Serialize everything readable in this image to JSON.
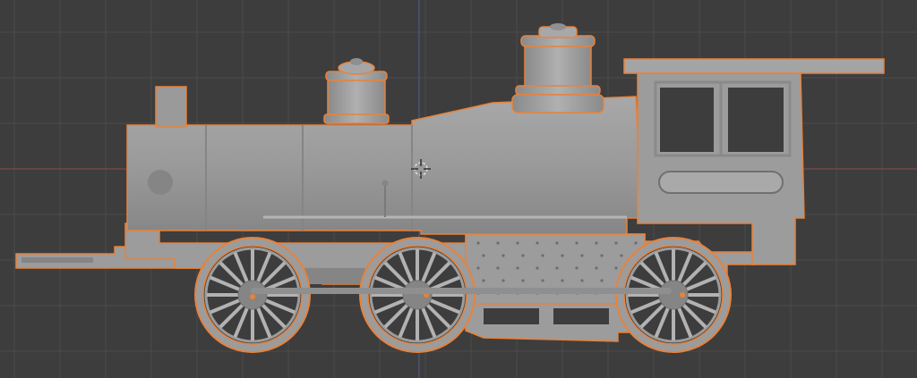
{
  "viewport": {
    "mode": "side-orthographic",
    "background": "#3d3d3d",
    "grid_color": "#4a4a4a",
    "x_axis_color": "#8a4a4a",
    "z_axis_color": "#4f5f8f"
  },
  "selection": {
    "outline_color": "#e8823a",
    "selected_object": "locomotive"
  },
  "model": {
    "body_color": "#9c9c9c",
    "shade_color": "#858585",
    "highlight_color": "#b2b2b2",
    "wheel_count": 3
  },
  "icons": {
    "origin": "3d-cursor-icon"
  }
}
